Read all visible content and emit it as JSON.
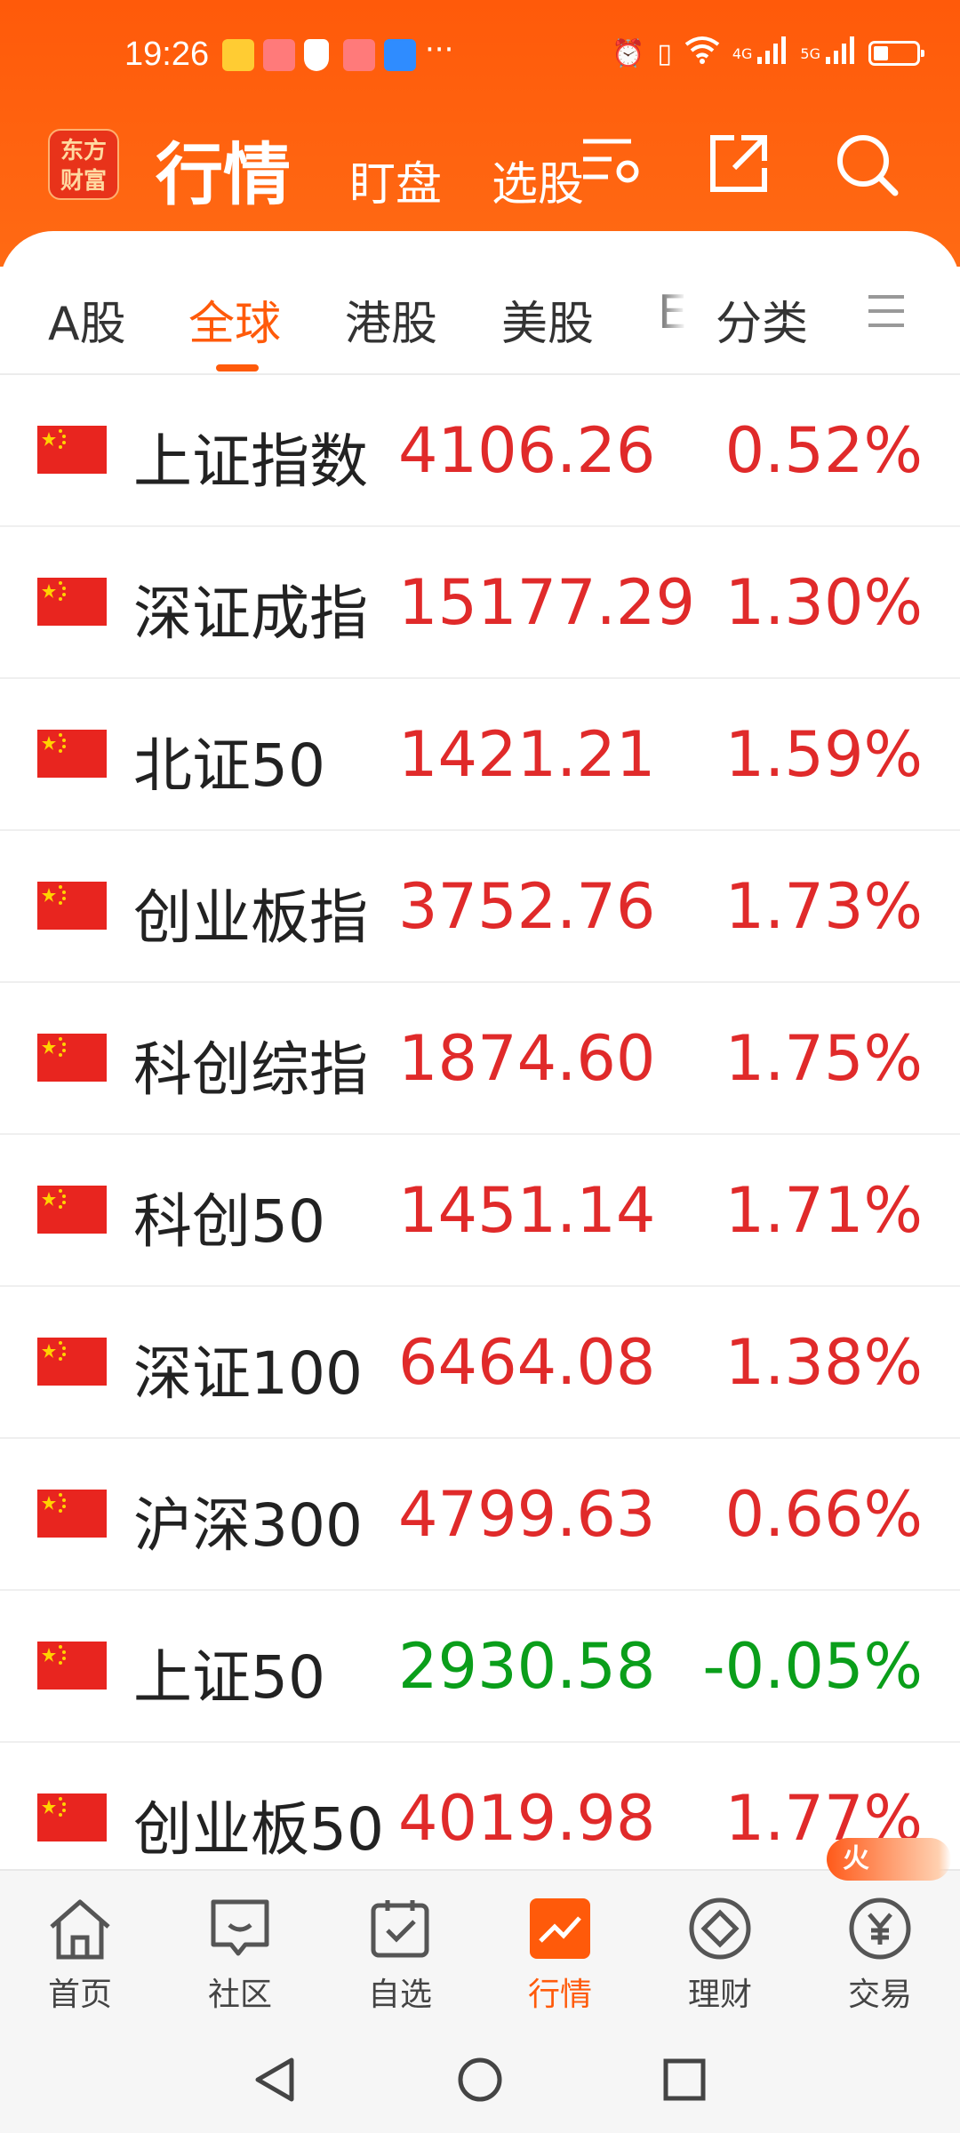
{
  "status_bar": {
    "time": "19:26",
    "more": "···",
    "net_4g": "4G",
    "net_5g": "5G"
  },
  "header": {
    "logo_line1": "东方",
    "logo_line2": "财富",
    "title": "行情",
    "tabs": [
      "盯盘",
      "选股"
    ],
    "accent_color": "#ff5a0a"
  },
  "market_tabs": [
    {
      "label": "A股",
      "active": false
    },
    {
      "label": "全球",
      "active": true
    },
    {
      "label": "港股",
      "active": false
    },
    {
      "label": "美股",
      "active": false
    },
    {
      "label": "E",
      "active": false
    },
    {
      "label": "分类",
      "active": false
    }
  ],
  "indices": [
    {
      "name": "上证指数",
      "price": "4106.26",
      "change": "0.52%",
      "direction": "up"
    },
    {
      "name": "深证成指",
      "price": "15177.29",
      "change": "1.30%",
      "direction": "up"
    },
    {
      "name": "北证50",
      "price": "1421.21",
      "change": "1.59%",
      "direction": "up"
    },
    {
      "name": "创业板指",
      "price": "3752.76",
      "change": "1.73%",
      "direction": "up"
    },
    {
      "name": "科创综指",
      "price": "1874.60",
      "change": "1.75%",
      "direction": "up"
    },
    {
      "name": "科创50",
      "price": "1451.14",
      "change": "1.71%",
      "direction": "up"
    },
    {
      "name": "深证100",
      "price": "6464.08",
      "change": "1.38%",
      "direction": "up"
    },
    {
      "name": "沪深300",
      "price": "4799.63",
      "change": "0.66%",
      "direction": "up"
    },
    {
      "name": "上证50",
      "price": "2930.58",
      "change": "-0.05%",
      "direction": "down"
    },
    {
      "name": "创业板50",
      "price": "4019.98",
      "change": "1.77%",
      "direction": "up"
    }
  ],
  "colors": {
    "up": "#e02a2a",
    "down": "#0a9e1a"
  },
  "bottom_nav": [
    {
      "label": "首页",
      "icon": "home-icon",
      "active": false
    },
    {
      "label": "社区",
      "icon": "chat-icon",
      "active": false
    },
    {
      "label": "自选",
      "icon": "checklist-icon",
      "active": false
    },
    {
      "label": "行情",
      "icon": "trend-chart-icon",
      "active": true
    },
    {
      "label": "理财",
      "icon": "diamond-icon",
      "active": false
    },
    {
      "label": "交易",
      "icon": "yuan-coin-icon",
      "active": false
    }
  ],
  "hot_badge": "火"
}
